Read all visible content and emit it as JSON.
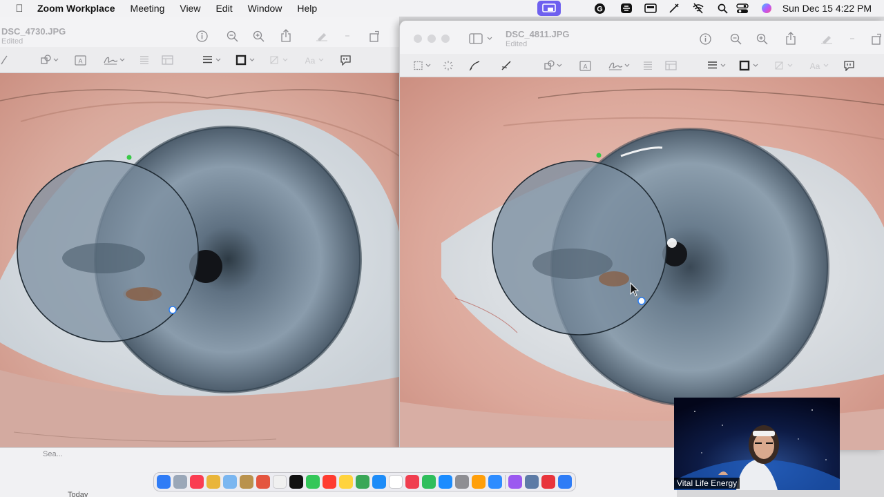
{
  "menubar": {
    "app_name": "Zoom Workplace",
    "menus": [
      "Meeting",
      "View",
      "Edit",
      "Window",
      "Help"
    ],
    "clock": "Sun Dec 15  4:22 PM",
    "status_icons": [
      "screen-share-indicator-icon",
      "grammarly-icon",
      "cloud-sync-icon",
      "display-icon",
      "pen-icon",
      "wifi-off-icon",
      "search-icon",
      "control-center-icon",
      "siri-icon"
    ],
    "share_indicator_color": "#6e60ef"
  },
  "left_window": {
    "filename": "DSC_4730.JPG",
    "status": "Edited",
    "iris_color": "#6e8294"
  },
  "right_window": {
    "filename": "DSC_4811.JPG",
    "status": "Edited",
    "iris_color": "#6f8396"
  },
  "finder": {
    "search_label": "Sea...",
    "section_label": "Today"
  },
  "dock": {
    "apps": [
      "finder",
      "launchpad",
      "music",
      "photos-grid",
      "photos",
      "notes-bag",
      "chrome",
      "reminders",
      "apple-tv",
      "messages",
      "calendar",
      "notes",
      "maps",
      "app-store-blue",
      "calendar-31",
      "news",
      "numbers",
      "app-store",
      "settings",
      "pages",
      "zoom",
      "podcasts",
      "preview",
      "acrobat",
      "safari"
    ],
    "app_colors": [
      "#2f7cf6",
      "#9aa7b8",
      "#fa3d52",
      "#e9b53a",
      "#7ab6f0",
      "#b9924d",
      "#e4553f",
      "#f0f0f0",
      "#111111",
      "#34c759",
      "#ff3b30",
      "#ffd33d",
      "#3aa757",
      "#1d8cf8",
      "#ffffff",
      "#f03e4f",
      "#2fbe5c",
      "#1a8cff",
      "#8e8e93",
      "#ff9f0a",
      "#2d8cff",
      "#9b59f0",
      "#5d7ba6",
      "#e8343c",
      "#2e7cf6"
    ]
  },
  "video": {
    "participant_name": "Vital Life Energy"
  }
}
